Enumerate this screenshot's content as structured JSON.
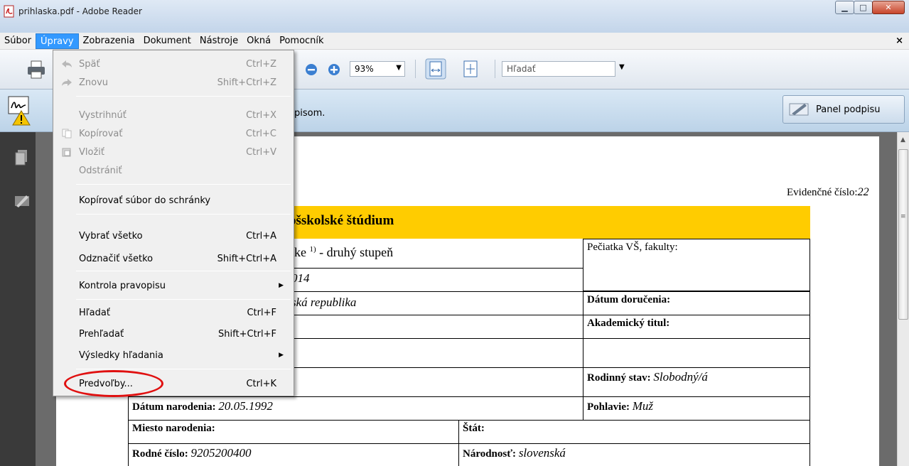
{
  "window": {
    "title": "prihlaska.pdf - Adobe Reader",
    "controls": [
      "minimize-icon",
      "maximize-icon",
      "close-icon"
    ]
  },
  "menubar": {
    "items": [
      "Súbor",
      "Úpravy",
      "Zobrazenia",
      "Dokument",
      "Nástroje",
      "Okná",
      "Pomocník"
    ],
    "active": "Úpravy",
    "close_doc": "×"
  },
  "toolbar": {
    "zoom": "93%",
    "search_placeholder": "Hľadať"
  },
  "signbar": {
    "text": "pisom.",
    "panel_button": "Panel podpisu"
  },
  "edit_menu": {
    "items": [
      {
        "label": "Späť",
        "shortcut": "Ctrl+Z",
        "disabled": true,
        "icon": "undo-icon"
      },
      {
        "label": "Znovu",
        "shortcut": "Shift+Ctrl+Z",
        "disabled": true,
        "icon": "redo-icon"
      },
      {
        "label": "Vystrihnúť",
        "shortcut": "Ctrl+X",
        "disabled": true
      },
      {
        "label": "Kopírovať",
        "shortcut": "Ctrl+C",
        "disabled": true,
        "icon": "copy-icon"
      },
      {
        "label": "Vložiť",
        "shortcut": "Ctrl+V",
        "disabled": true,
        "icon": "paste-icon"
      },
      {
        "label": "Odstrániť",
        "shortcut": "",
        "disabled": true
      },
      {
        "label": "Kopírovať súbor do schránky",
        "shortcut": ""
      },
      {
        "label": "Vybrať všetko",
        "shortcut": "Ctrl+A"
      },
      {
        "label": "Odznačiť všetko",
        "shortcut": "Shift+Ctrl+A"
      },
      {
        "label": "Kontrola pravopisu",
        "shortcut": "",
        "submenu": true
      },
      {
        "label": "Hľadať",
        "shortcut": "Ctrl+F"
      },
      {
        "label": "Prehľadať",
        "shortcut": "Shift+Ctrl+F"
      },
      {
        "label": "Výsledky hľadania",
        "shortcut": "",
        "submenu": true
      },
      {
        "label": "Predvoľby...",
        "shortcut": "Ctrl+K",
        "highlighted": true
      }
    ]
  },
  "document": {
    "evidencne_label": "Evidenčné číslo:",
    "evidencne_value": "22",
    "banner_title": "ošskolské štúdium",
    "banner_line2": "ske",
    "banner_sup": "1)",
    "banner_line2_rest": " - druhý stupeň",
    "frag_year": "014",
    "frag_republic": "ská republika",
    "peciatka": "Pečiatka VŠ, fakulty:",
    "datum_dorucenia": "Dátum doručenia:",
    "akademicky_titul": "Akademický titul:",
    "rodinny_stav_label": "Rodinný stav:",
    "rodinny_stav_value": "Slobodný/á",
    "datum_narodenia_label": "Dátum narodenia:",
    "datum_narodenia_value": "20.05.1992",
    "pohlavie_label": "Pohlavie:",
    "pohlavie_value": "Muž",
    "miesto_narodenia": "Miesto narodenia:",
    "stat": "Štát:",
    "rodne_cislo_label": "Rodné číslo:",
    "rodne_cislo_value": "9205200400",
    "narodnost_label": "Národnosť:",
    "narodnost_value": "slovenská"
  },
  "colors": {
    "banner": "#ffcc00",
    "menu_highlight": "#3399ff",
    "annotation": "#e01010"
  }
}
